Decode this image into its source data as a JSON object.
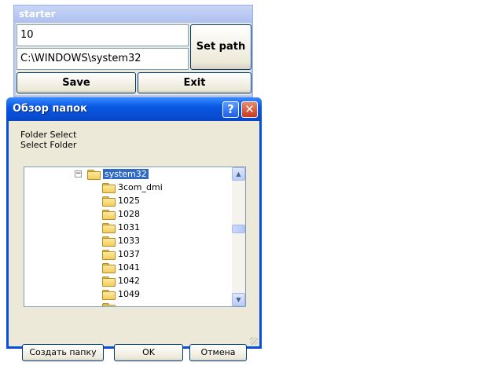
{
  "starter": {
    "title": "starter",
    "number_value": "10",
    "path_value": "C:\\WINDOWS\\system32",
    "set_path_label": "Set path",
    "save_label": "Save",
    "exit_label": "Exit"
  },
  "dialog": {
    "title": "Обзор папок",
    "help_glyph": "?",
    "close_glyph": "✕",
    "line1": "Folder Select",
    "line2": "Select Folder",
    "tree": {
      "selected": "system32",
      "expander_glyph": "−",
      "items": [
        "3com_dmi",
        "1025",
        "1028",
        "1031",
        "1033",
        "1037",
        "1041",
        "1042",
        "1049"
      ]
    },
    "scroll_up_glyph": "▲",
    "scroll_down_glyph": "▼",
    "new_folder_label": "Создать папку",
    "ok_label": "OK",
    "cancel_label": "Отмена"
  },
  "colors": {
    "titlebar_blue": "#0857e3",
    "selection": "#316ac5",
    "window_face": "#ece9d8"
  }
}
